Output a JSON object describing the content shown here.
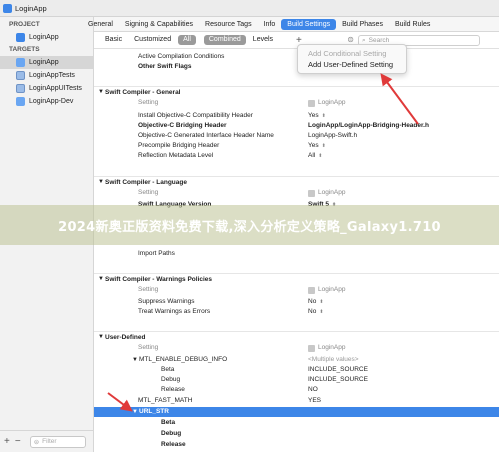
{
  "window": {
    "title": "LoginApp"
  },
  "sidebar": {
    "project_header": "PROJECT",
    "project_item": "LoginApp",
    "targets_header": "TARGETS",
    "targets": [
      "LoginApp",
      "LoginAppTests",
      "LoginAppUITests",
      "LoginApp-Dev"
    ],
    "filter_placeholder": "Filter"
  },
  "tabs": [
    "General",
    "Signing & Capabilities",
    "Resource Tags",
    "Info",
    "Build Settings",
    "Build Phases",
    "Build Rules"
  ],
  "active_tab": "Build Settings",
  "filterbar": {
    "basic": "Basic",
    "customized": "Customized",
    "all": "All",
    "combined": "Combined",
    "levels": "Levels",
    "plus": "+",
    "search_placeholder": "Search"
  },
  "popup": {
    "items": [
      "Add Conditional Setting",
      "Add User-Defined Setting"
    ]
  },
  "settings": {
    "top_rows": [
      {
        "name": "Active Compilation Conditions",
        "bold": false
      },
      {
        "name": "Other Swift Flags",
        "bold": true
      }
    ],
    "swift_general": {
      "title": "Swift Compiler - General",
      "setting_label": "Setting",
      "target_label": "LoginApp",
      "rows": [
        {
          "name": "Install Objective-C Compatibility Header",
          "value": "Yes",
          "bold": false
        },
        {
          "name": "Objective-C Bridging Header",
          "value": "LoginApp/LoginApp-Bridging-Header.h",
          "bold": true
        },
        {
          "name": "Objective-C Generated Interface Header Name",
          "value": "LoginApp-Swift.h",
          "bold": false
        },
        {
          "name": "Precompile Bridging Header",
          "value": "Yes",
          "bold": false
        },
        {
          "name": "Reflection Metadata Level",
          "value": "All",
          "bold": false
        }
      ]
    },
    "swift_language": {
      "title": "Swift Compiler - Language",
      "setting_label": "Setting",
      "target_label": "LoginApp",
      "rows": [
        {
          "name": "Swift Language Version",
          "value": "Swift 5",
          "bold": true
        },
        {
          "name": "Import Paths",
          "value": "",
          "bold": false
        }
      ]
    },
    "swift_warnings": {
      "title": "Swift Compiler - Warnings Policies",
      "setting_label": "Setting",
      "target_label": "LoginApp",
      "rows": [
        {
          "name": "Suppress Warnings",
          "value": "No"
        },
        {
          "name": "Treat Warnings as Errors",
          "value": "No"
        }
      ]
    },
    "user_defined": {
      "title": "User-Defined",
      "setting_label": "Setting",
      "target_label": "LoginApp",
      "debug_info_name": "MTL_ENABLE_DEBUG_INFO",
      "debug_info_value": "<Multiple values>",
      "debug_info_rows": [
        {
          "name": "Beta",
          "value": "INCLUDE_SOURCE"
        },
        {
          "name": "Debug",
          "value": "INCLUDE_SOURCE"
        },
        {
          "name": "Release",
          "value": "NO"
        }
      ],
      "fast_math_name": "MTL_FAST_MATH",
      "fast_math_value": "YES",
      "url_str_name": "URL_STR",
      "url_str_rows": [
        "Beta",
        "Debug",
        "Release"
      ]
    }
  },
  "watermark": "2024新奥正版资料免费下载,深入分析定义策略_Galaxy1.710",
  "colors": {
    "accent": "#3d86e8",
    "annotation_arrow": "#e03a3a"
  }
}
